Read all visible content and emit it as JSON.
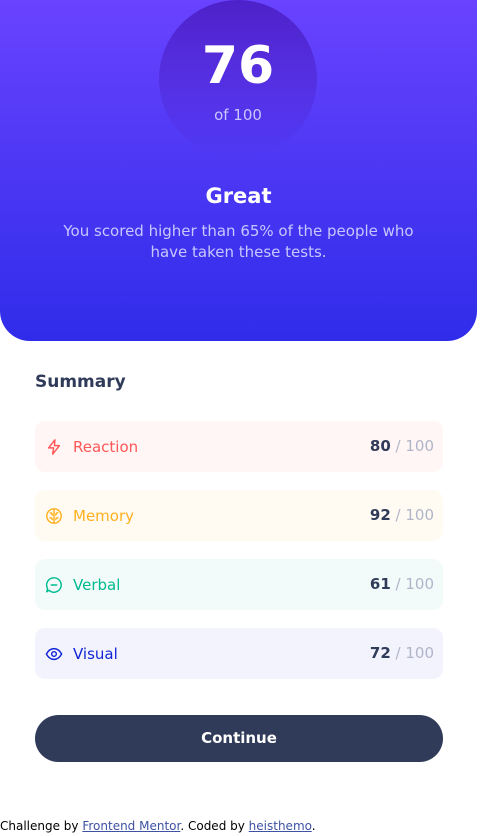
{
  "result": {
    "score": "76",
    "max": "of 100",
    "title": "Great",
    "description": "You scored higher than 65% of the people who have taken these tests."
  },
  "summary": {
    "title": "Summary",
    "items": [
      {
        "label": "Reaction",
        "score": "80",
        "max": " / 100",
        "icon": "lightning-icon",
        "color": "#ff5757"
      },
      {
        "label": "Memory",
        "score": "92",
        "max": " / 100",
        "icon": "brain-icon",
        "color": "#ffb01f"
      },
      {
        "label": "Verbal",
        "score": "61",
        "max": " / 100",
        "icon": "chat-icon",
        "color": "#00bb8f"
      },
      {
        "label": "Visual",
        "score": "72",
        "max": " / 100",
        "icon": "eye-icon",
        "color": "#1125d6"
      }
    ]
  },
  "continue_label": "Continue",
  "attribution": {
    "prefix": "Challenge by ",
    "link1": "Frontend Mentor",
    "middle": ". Coded by ",
    "link2": "heisthemo",
    "suffix": "."
  },
  "colors": {
    "gradient_top": "#6943ff",
    "gradient_bottom": "#2f2ce9",
    "dark": "#303b59"
  }
}
